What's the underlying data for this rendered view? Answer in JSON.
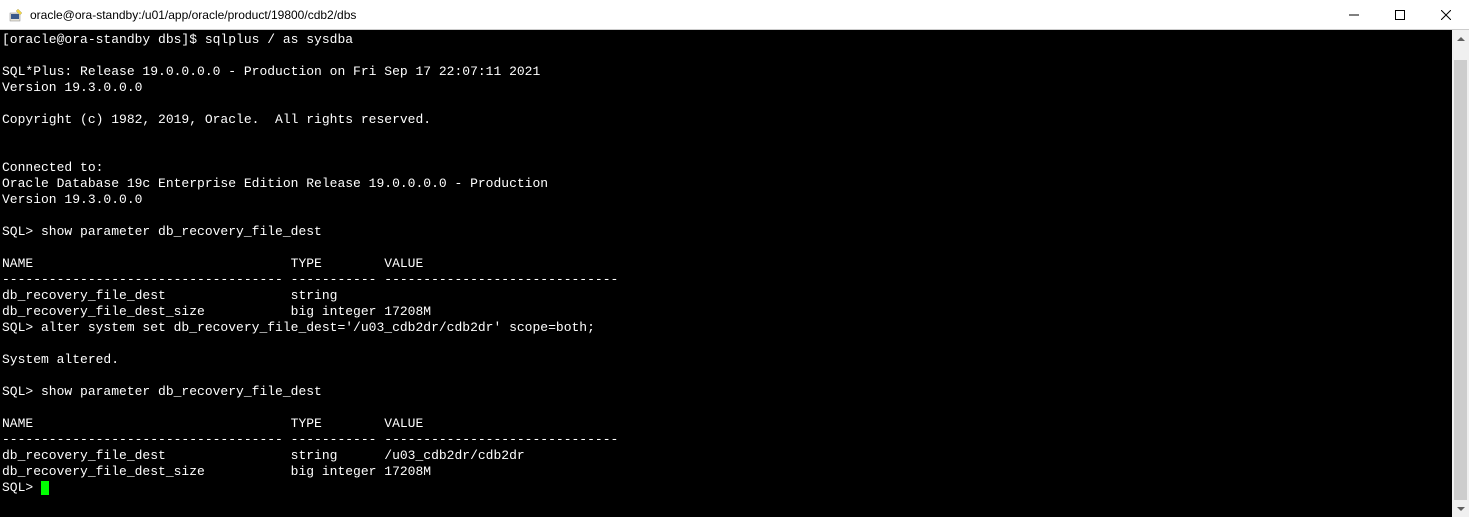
{
  "window": {
    "title": "oracle@ora-standby:/u01/app/oracle/product/19800/cdb2/dbs"
  },
  "terminal": {
    "lines": [
      "[oracle@ora-standby dbs]$ sqlplus / as sysdba",
      "",
      "SQL*Plus: Release 19.0.0.0.0 - Production on Fri Sep 17 22:07:11 2021",
      "Version 19.3.0.0.0",
      "",
      "Copyright (c) 1982, 2019, Oracle.  All rights reserved.",
      "",
      "",
      "Connected to:",
      "Oracle Database 19c Enterprise Edition Release 19.0.0.0.0 - Production",
      "Version 19.3.0.0.0",
      "",
      "SQL> show parameter db_recovery_file_dest",
      "",
      "NAME                                 TYPE        VALUE",
      "------------------------------------ ----------- ------------------------------",
      "db_recovery_file_dest                string",
      "db_recovery_file_dest_size           big integer 17208M",
      "SQL> alter system set db_recovery_file_dest='/u03_cdb2dr/cdb2dr' scope=both;",
      "",
      "System altered.",
      "",
      "SQL> show parameter db_recovery_file_dest",
      "",
      "NAME                                 TYPE        VALUE",
      "------------------------------------ ----------- ------------------------------",
      "db_recovery_file_dest                string      /u03_cdb2dr/cdb2dr",
      "db_recovery_file_dest_size           big integer 17208M"
    ],
    "prompt": "SQL> "
  }
}
